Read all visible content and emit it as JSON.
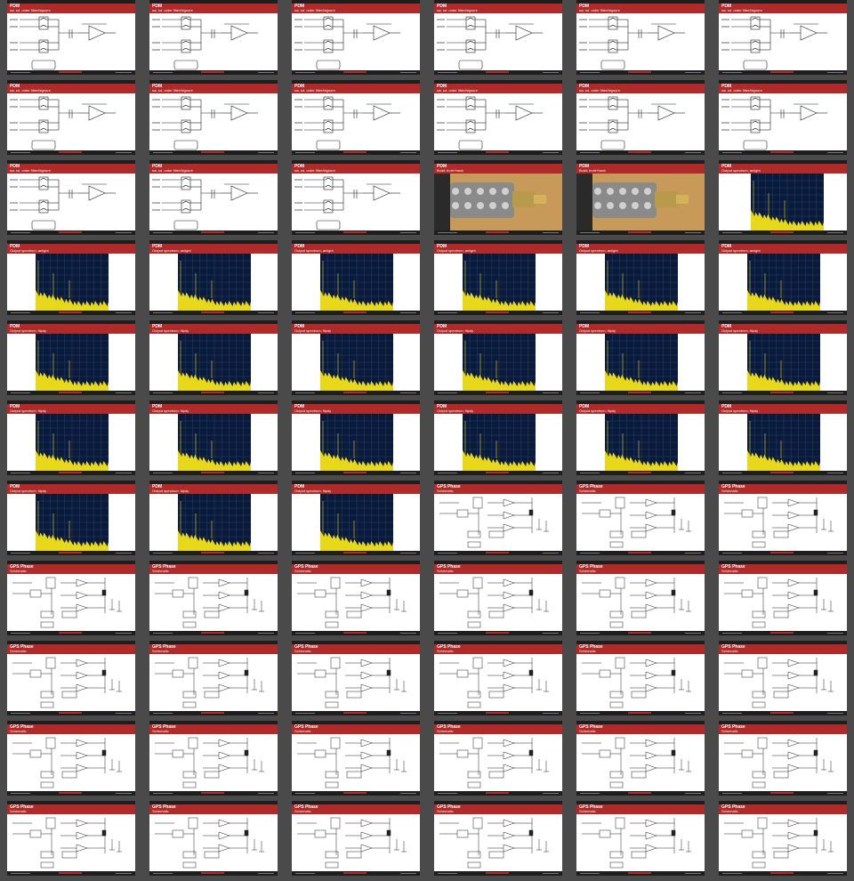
{
  "colors": {
    "background": "#4a4a4a",
    "header": "#b02a2a",
    "bar": "#1e1e1e",
    "scope_bg": "#0a1a3a",
    "scope_trace": "#e8d81a",
    "photo_bg": "#c89a5a"
  },
  "slide_types": {
    "pdm": {
      "title": "PDM",
      "subtitle": "sw. sd. order filter/bignore"
    },
    "photo": {
      "title": "PDM",
      "subtitle": "Build: front+back"
    },
    "spectrum_a": {
      "title": "PDM",
      "subtitle": "Output spectrum, anlight"
    },
    "spectrum_b": {
      "title": "PDM",
      "subtitle": "Output spectrum, flipdy"
    },
    "gps": {
      "title": "GPS Phase",
      "subtitle": "Schematic"
    }
  },
  "slides": [
    "pdm",
    "pdm",
    "pdm",
    "pdm",
    "pdm",
    "pdm",
    "pdm",
    "pdm",
    "pdm",
    "pdm",
    "pdm",
    "pdm",
    "pdm",
    "pdm",
    "pdm",
    "photo",
    "photo",
    "spectrum_a",
    "spectrum_a",
    "spectrum_a",
    "spectrum_a",
    "spectrum_a",
    "spectrum_a",
    "spectrum_a",
    "spectrum_b",
    "spectrum_b",
    "spectrum_b",
    "spectrum_b",
    "spectrum_b",
    "spectrum_b",
    "spectrum_b",
    "spectrum_b",
    "spectrum_b",
    "spectrum_b",
    "spectrum_b",
    "spectrum_b",
    "spectrum_b",
    "spectrum_b",
    "spectrum_b",
    "gps",
    "gps",
    "gps",
    "gps",
    "gps",
    "gps",
    "gps",
    "gps",
    "gps",
    "gps",
    "gps",
    "gps",
    "gps",
    "gps",
    "gps",
    "gps",
    "gps",
    "gps",
    "gps",
    "gps",
    "gps",
    "gps",
    "gps",
    "gps",
    "gps",
    "gps",
    "gps"
  ]
}
